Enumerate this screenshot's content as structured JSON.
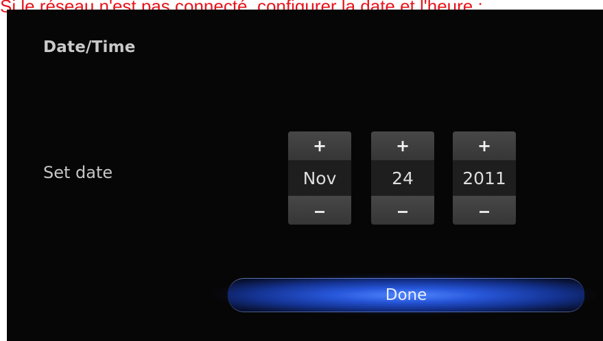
{
  "caption": "Si le réseau n'est pas connecté, configurer la date et l'heure :",
  "screen": {
    "title": "Date/Time",
    "set_date_label": "Set date",
    "plus_symbol": "+",
    "date": {
      "month": "Nov",
      "day": "24",
      "year": "2011"
    },
    "done_label": "Done"
  },
  "colors": {
    "caption": "#e8141b",
    "background": "#070606",
    "accent": "#2756d9"
  }
}
